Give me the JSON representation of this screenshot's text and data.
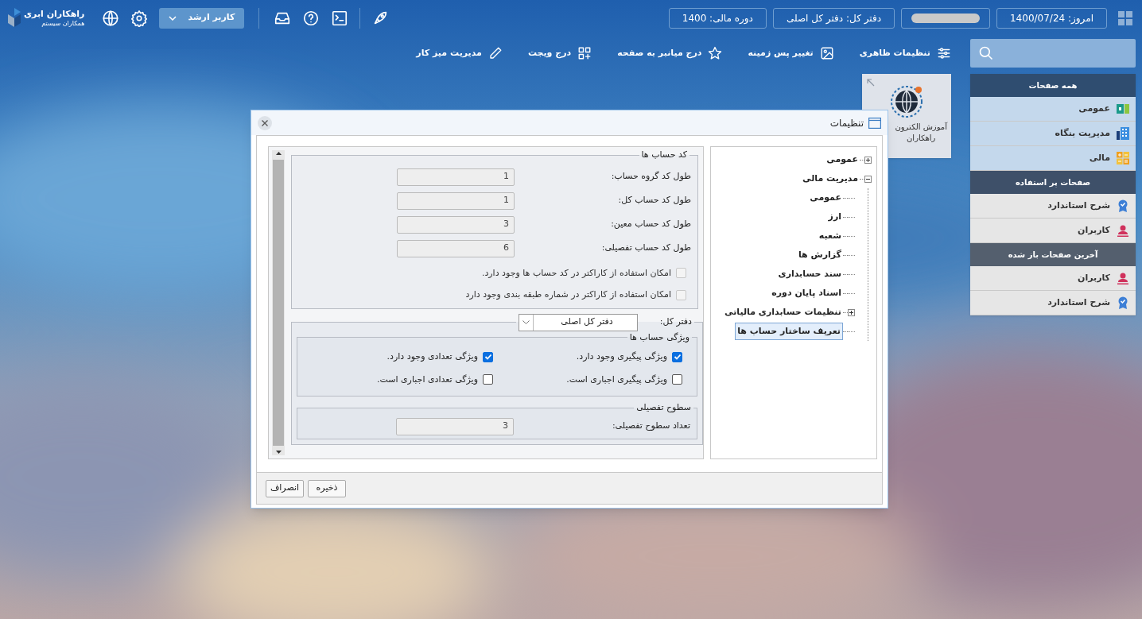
{
  "topbar": {
    "status": [
      {
        "kind": "text",
        "text": "امروز: 1400/07/24"
      },
      {
        "kind": "redacted"
      },
      {
        "kind": "text",
        "text": "دفتر کل: دفتر کل اصلی"
      },
      {
        "kind": "text",
        "text": "دوره مالی: 1400"
      }
    ],
    "user": "کاربر ارشد",
    "logo": {
      "title": "راهکاران ابری",
      "subtitle": "همکاران سیستم"
    }
  },
  "toolbar": [
    "تنظیمات ظاهری",
    "تغییر پس زمینه",
    "درج میانبر به صفحه",
    "درج ویجت",
    "مدیریت میز کار"
  ],
  "sidebar": [
    {
      "title": "همه صفحات",
      "items": [
        {
          "label": "عمومی",
          "kind": "money"
        },
        {
          "label": "مدیریت بنگاه",
          "kind": "building"
        },
        {
          "label": "مالی",
          "kind": "calculator"
        }
      ]
    },
    {
      "title": "صفحات پر استفاده",
      "items": [
        {
          "label": "شرح استاندارد",
          "kind": "badge"
        },
        {
          "label": "کاربران",
          "kind": "user"
        }
      ]
    },
    {
      "title": "آخرین صفحات باز شده",
      "items": [
        {
          "label": "کاربران",
          "kind": "user"
        },
        {
          "label": "شرح استاندارد",
          "kind": "badge"
        }
      ]
    }
  ],
  "widget": {
    "lines": [
      "آموزش الکترون",
      "راهکاران"
    ]
  },
  "dialog": {
    "title": "تنظیمات",
    "tree": [
      {
        "label": "عمومی",
        "expanded": false,
        "selected": false
      },
      {
        "label": "مدیریت مالی",
        "expanded": true,
        "selected": false,
        "children": [
          {
            "label": "عمومی",
            "selected": false
          },
          {
            "label": "ارز",
            "selected": false
          },
          {
            "label": "شعبه",
            "selected": false
          },
          {
            "label": "گزارش ها",
            "selected": false
          },
          {
            "label": "سند حسابداری",
            "selected": false
          },
          {
            "label": "اسناد پایان دوره",
            "selected": false
          },
          {
            "label": "تنظیمات حسابداری مالیاتی",
            "expanded": false,
            "selected": false
          },
          {
            "label": "تعریف ساختار حساب ها",
            "selected": true
          }
        ]
      }
    ],
    "account_codes": {
      "legend": "کد حساب ها",
      "fields": [
        {
          "label": "طول کد گروه حساب:",
          "value": "1"
        },
        {
          "label": "طول کد حساب کل:",
          "value": "1"
        },
        {
          "label": "طول کد حساب معین:",
          "value": "3"
        },
        {
          "label": "طول کد حساب تفصیلی:",
          "value": "6"
        }
      ],
      "options": [
        {
          "label": "امکان استفاده از کاراکتر در کد حساب ها وجود دارد.",
          "checked": false,
          "disabled": true
        },
        {
          "label": "امکان استفاده از کاراکتر در شماره طبقه بندی وجود دارد",
          "checked": false,
          "disabled": true
        }
      ]
    },
    "ledger": {
      "label": "دفتر کل:",
      "value": "دفتر کل اصلی"
    },
    "features": {
      "legend": "ویژگی حساب ها",
      "options": [
        {
          "label": "ویژگی پیگیری وجود دارد.",
          "checked": true,
          "disabled": false
        },
        {
          "label": "ویژگی تعدادی وجود دارد.",
          "checked": true,
          "disabled": false
        },
        {
          "label": "ویژگی پیگیری اجباری است.",
          "checked": false,
          "disabled": false
        },
        {
          "label": "ویژگی تعدادی اجباری است.",
          "checked": false,
          "disabled": false
        }
      ]
    },
    "levels": {
      "legend": "سطوح تفصیلی",
      "fields": [
        {
          "label": "تعداد سطوح تفصیلی:",
          "value": "3"
        }
      ]
    },
    "buttons": [
      "ذخیره",
      "انصراف"
    ]
  }
}
